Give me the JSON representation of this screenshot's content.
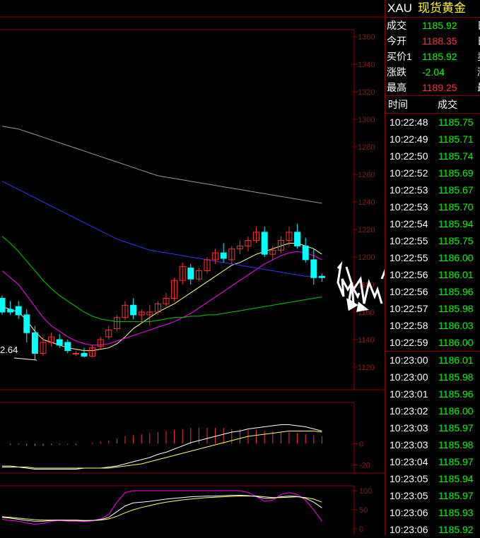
{
  "header": {
    "symbol": "XAU",
    "name": "现货黄金"
  },
  "quote": [
    {
      "label": "成交",
      "value": "1185.92",
      "color": "#00ff00",
      "side": "日"
    },
    {
      "label": "今开",
      "value": "1188.35",
      "color": "#ff3030",
      "side": "日"
    },
    {
      "label": "买价1",
      "value": "1185.92",
      "color": "#00ff00",
      "side": "卖"
    },
    {
      "label": "涨跌",
      "value": "-2.04",
      "color": "#00ff00",
      "side": "涨"
    },
    {
      "label": "最高",
      "value": "1189.25",
      "color": "#ff3030",
      "side": "最"
    }
  ],
  "ticks_header": {
    "time": "时间",
    "price": "成交"
  },
  "ticks": [
    {
      "time": "10:22:48",
      "price": "1185.75"
    },
    {
      "time": "10:22:49",
      "price": "1185.71"
    },
    {
      "time": "10:22:50",
      "price": "1185.74"
    },
    {
      "time": "10:22:52",
      "price": "1185.69"
    },
    {
      "time": "10:22:53",
      "price": "1185.67"
    },
    {
      "time": "10:22:53",
      "price": "1185.70"
    },
    {
      "time": "10:22:54",
      "price": "1185.94"
    },
    {
      "time": "10:22:55",
      "price": "1185.75"
    },
    {
      "time": "10:22:55",
      "price": "1186.00"
    },
    {
      "time": "10:22:56",
      "price": "1186.01"
    },
    {
      "time": "10:22:56",
      "price": "1185.96"
    },
    {
      "time": "10:22:57",
      "price": "1185.98"
    },
    {
      "time": "10:22:58",
      "price": "1186.03"
    },
    {
      "time": "10:22:59",
      "price": "1186.00"
    },
    {
      "time": "10:23:00",
      "price": "1186.01"
    },
    {
      "time": "10:23:00",
      "price": "1185.98"
    },
    {
      "time": "10:23:01",
      "price": "1185.96"
    },
    {
      "time": "10:23:02",
      "price": "1186.00"
    },
    {
      "time": "10:23:03",
      "price": "1185.97"
    },
    {
      "time": "10:23:03",
      "price": "1185.98"
    },
    {
      "time": "10:23:04",
      "price": "1185.97"
    },
    {
      "time": "10:23:05",
      "price": "1185.94"
    },
    {
      "time": "10:23:05",
      "price": "1185.97"
    },
    {
      "time": "10:23:06",
      "price": "1185.93"
    },
    {
      "time": "10:23:06",
      "price": "1185.92"
    }
  ],
  "main_axis_labels": [
    "1360",
    "1340",
    "1320",
    "1300",
    "1280",
    "1260",
    "1240",
    "1220",
    "1200",
    "1180",
    "1160",
    "1140",
    "1120"
  ],
  "main_axis_values": [
    1360,
    1340,
    1320,
    1300,
    1280,
    1260,
    1240,
    1220,
    1200,
    1180,
    1160,
    1140,
    1120
  ],
  "low_marker": "2.64",
  "macd_axis_labels": [
    "0",
    "-20"
  ],
  "kdj_axis_labels": [
    "100",
    "50",
    "0"
  ],
  "colors": {
    "border": "#8b0000",
    "up": "#ff3030",
    "down": "#00ffff",
    "tick_price": "#00ff00",
    "ma1": "#ffff99",
    "ma2": "#ff00ff",
    "ma3": "#00cc00",
    "ma4": "#3333ff",
    "ma5": "#999999"
  },
  "chart_data": {
    "type": "candlestick",
    "yrange": [
      1110,
      1365
    ],
    "candles": [
      [
        1170,
        1172,
        1158,
        1160
      ],
      [
        1162,
        1168,
        1158,
        1160
      ],
      [
        1164,
        1168,
        1155,
        1158
      ],
      [
        1158,
        1162,
        1138,
        1145
      ],
      [
        1145,
        1150,
        1125,
        1130
      ],
      [
        1130,
        1142,
        1128,
        1138
      ],
      [
        1138,
        1145,
        1135,
        1142
      ],
      [
        1140,
        1144,
        1134,
        1136
      ],
      [
        1138,
        1140,
        1130,
        1132
      ],
      [
        1130,
        1132,
        1128,
        1130
      ],
      [
        1130,
        1134,
        1127,
        1128
      ],
      [
        1128,
        1136,
        1127,
        1134
      ],
      [
        1135,
        1142,
        1133,
        1140
      ],
      [
        1142,
        1150,
        1140,
        1147
      ],
      [
        1148,
        1158,
        1146,
        1156
      ],
      [
        1156,
        1168,
        1154,
        1165
      ],
      [
        1165,
        1170,
        1155,
        1158
      ],
      [
        1158,
        1162,
        1152,
        1160
      ],
      [
        1158,
        1165,
        1150,
        1160
      ],
      [
        1160,
        1168,
        1158,
        1166
      ],
      [
        1166,
        1174,
        1164,
        1170
      ],
      [
        1170,
        1185,
        1168,
        1183
      ],
      [
        1183,
        1196,
        1180,
        1193
      ],
      [
        1192,
        1195,
        1180,
        1184
      ],
      [
        1184,
        1192,
        1182,
        1190
      ],
      [
        1190,
        1200,
        1188,
        1198
      ],
      [
        1198,
        1206,
        1195,
        1203
      ],
      [
        1203,
        1210,
        1196,
        1199
      ],
      [
        1198,
        1208,
        1195,
        1206
      ],
      [
        1206,
        1212,
        1202,
        1208
      ],
      [
        1208,
        1215,
        1204,
        1212
      ],
      [
        1212,
        1222,
        1210,
        1218
      ],
      [
        1218,
        1222,
        1200,
        1202
      ],
      [
        1202,
        1208,
        1198,
        1205
      ],
      [
        1205,
        1215,
        1203,
        1212
      ],
      [
        1212,
        1222,
        1208,
        1218
      ],
      [
        1218,
        1224,
        1206,
        1208
      ],
      [
        1208,
        1214,
        1196,
        1198
      ],
      [
        1198,
        1206,
        1180,
        1185
      ],
      [
        1186,
        1188,
        1182,
        1185
      ]
    ],
    "ma": {
      "ma1": [
        1164,
        1162,
        1160,
        1154,
        1146,
        1140,
        1138,
        1136,
        1134,
        1133,
        1132,
        1132,
        1133,
        1134,
        1137,
        1142,
        1148,
        1152,
        1156,
        1160,
        1163,
        1166,
        1170,
        1174,
        1178,
        1182,
        1186,
        1190,
        1194,
        1196,
        1199,
        1202,
        1204,
        1206,
        1208,
        1210,
        1210,
        1208,
        1206,
        1202
      ],
      "ma2": [
        1190,
        1185,
        1180,
        1172,
        1164,
        1156,
        1150,
        1146,
        1142,
        1139,
        1137,
        1136,
        1136,
        1137,
        1139,
        1141,
        1143,
        1145,
        1147,
        1149,
        1151,
        1153,
        1156,
        1159,
        1163,
        1167,
        1171,
        1175,
        1179,
        1183,
        1187,
        1191,
        1195,
        1198,
        1201,
        1203,
        1204,
        1203,
        1201,
        1198
      ],
      "ma3": [
        1215,
        1210,
        1204,
        1197,
        1190,
        1183,
        1177,
        1172,
        1168,
        1164,
        1160,
        1157,
        1155,
        1154,
        1153,
        1153,
        1153,
        1153,
        1153,
        1154,
        1155,
        1156,
        1156,
        1157,
        1157,
        1158,
        1158,
        1159,
        1160,
        1161,
        1162,
        1163,
        1164,
        1165,
        1166,
        1167,
        1168,
        1169,
        1170,
        1171
      ],
      "ma4": [
        1255,
        1252,
        1249,
        1246,
        1243,
        1240,
        1237,
        1234,
        1231,
        1228,
        1225,
        1222,
        1219,
        1216,
        1213,
        1211,
        1209,
        1207,
        1205,
        1204,
        1203,
        1202,
        1201,
        1200,
        1199,
        1198,
        1197,
        1196,
        1195,
        1194,
        1193,
        1192,
        1191,
        1190,
        1189,
        1188,
        1187,
        1186,
        1186,
        1185
      ],
      "ma5": [
        1295,
        1294,
        1293,
        1291,
        1289,
        1287,
        1285,
        1283,
        1281,
        1279,
        1277,
        1275,
        1273,
        1271,
        1269,
        1267,
        1265,
        1263,
        1261,
        1259,
        1258,
        1257,
        1256,
        1255,
        1254,
        1253,
        1252,
        1251,
        1250,
        1249,
        1248,
        1247,
        1246,
        1245,
        1244,
        1243,
        1242,
        1241,
        1240,
        1239
      ]
    },
    "macd": {
      "yrange": [
        -25,
        35
      ],
      "bars": [
        0,
        -1,
        -1,
        -2,
        -2,
        -2,
        -1,
        -1,
        -1,
        -1,
        0,
        1,
        2,
        3,
        5,
        7,
        8,
        9,
        10,
        11,
        12,
        13,
        14,
        15,
        15,
        15,
        15,
        15,
        14,
        14,
        13,
        13,
        12,
        12,
        11,
        11,
        10,
        9,
        8,
        7
      ],
      "dif": [
        -22,
        -22,
        -22,
        -23,
        -24,
        -24,
        -24,
        -24,
        -24,
        -24,
        -23,
        -23,
        -23,
        -22,
        -21,
        -19,
        -17,
        -15,
        -13,
        -10,
        -8,
        -5,
        -2,
        1,
        3,
        5,
        7,
        9,
        11,
        12,
        14,
        15,
        16,
        17,
        18,
        18,
        17,
        16,
        14,
        12
      ],
      "dea": [
        -21,
        -21,
        -22,
        -22,
        -23,
        -23,
        -23,
        -23,
        -23,
        -23,
        -23,
        -23,
        -23,
        -23,
        -22,
        -21,
        -20,
        -19,
        -17,
        -15,
        -13,
        -11,
        -9,
        -7,
        -5,
        -3,
        -1,
        1,
        3,
        5,
        7,
        8,
        9,
        10,
        11,
        12,
        12,
        12,
        12,
        11
      ]
    },
    "kdj": {
      "yrange": [
        0,
        100
      ],
      "k": [
        30,
        28,
        25,
        22,
        20,
        20,
        22,
        23,
        22,
        22,
        21,
        22,
        24,
        30,
        45,
        60,
        68,
        70,
        72,
        75,
        78,
        80,
        82,
        84,
        85,
        86,
        86,
        87,
        88,
        88,
        87,
        85,
        80,
        80,
        84,
        86,
        85,
        80,
        70,
        55
      ],
      "d": [
        32,
        30,
        28,
        26,
        24,
        23,
        23,
        23,
        23,
        23,
        22,
        22,
        23,
        26,
        33,
        42,
        50,
        56,
        61,
        66,
        70,
        73,
        76,
        78,
        80,
        82,
        83,
        84,
        85,
        86,
        86,
        86,
        84,
        82,
        82,
        83,
        84,
        82,
        78,
        70
      ],
      "j": [
        25,
        22,
        20,
        15,
        12,
        14,
        20,
        22,
        20,
        20,
        19,
        21,
        26,
        38,
        70,
        95,
        100,
        100,
        100,
        100,
        100,
        100,
        100,
        100,
        100,
        100,
        100,
        100,
        100,
        100,
        95,
        85,
        72,
        75,
        90,
        95,
        90,
        75,
        50,
        20
      ]
    }
  }
}
